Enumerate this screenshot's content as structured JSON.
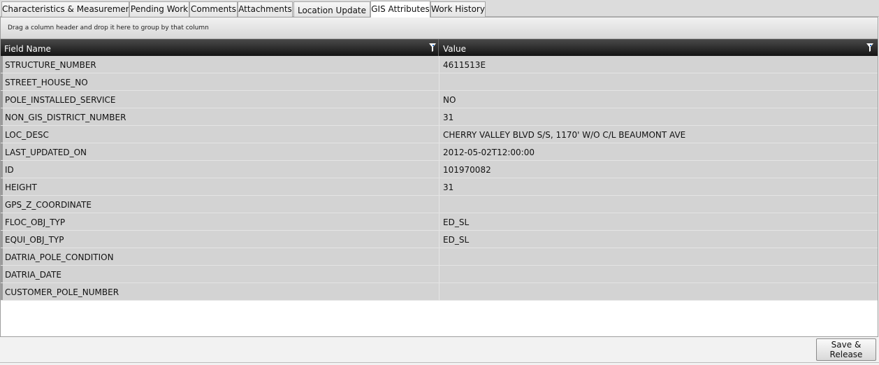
{
  "tabs": [
    {
      "label": "Characteristics & Measurements"
    },
    {
      "label": "Pending Work"
    },
    {
      "label": "Comments"
    },
    {
      "label": "Attachments"
    },
    {
      "label": "Location Update"
    },
    {
      "label": "GIS Attributes"
    },
    {
      "label": "Work History"
    }
  ],
  "active_tab": "GIS Attributes",
  "group_panel_text": "Drag a column header and drop it here to group by that column",
  "grid": {
    "columns": [
      {
        "label": "Field Name",
        "filter_icon": "funnel-filter-icon"
      },
      {
        "label": "Value",
        "filter_icon": "funnel-filter-icon"
      }
    ],
    "rows": [
      {
        "field": "STRUCTURE_NUMBER",
        "value": "4611513E"
      },
      {
        "field": "STREET_HOUSE_NO",
        "value": ""
      },
      {
        "field": "POLE_INSTALLED_SERVICE",
        "value": "NO"
      },
      {
        "field": "NON_GIS_DISTRICT_NUMBER",
        "value": "31"
      },
      {
        "field": "LOC_DESC",
        "value": "CHERRY VALLEY BLVD S/S, 1170' W/O C/L BEAUMONT AVE"
      },
      {
        "field": "LAST_UPDATED_ON",
        "value": "2012-05-02T12:00:00"
      },
      {
        "field": "ID",
        "value": "101970082"
      },
      {
        "field": "HEIGHT",
        "value": "31"
      },
      {
        "field": "GPS_Z_COORDINATE",
        "value": ""
      },
      {
        "field": "FLOC_OBJ_TYP",
        "value": "ED_SL"
      },
      {
        "field": "EQUI_OBJ_TYP",
        "value": "ED_SL"
      },
      {
        "field": "DATRIA_POLE_CONDITION",
        "value": ""
      },
      {
        "field": "DATRIA_DATE",
        "value": ""
      },
      {
        "field": "CUSTOMER_POLE_NUMBER",
        "value": ""
      }
    ]
  },
  "footer": {
    "save_release_label": "Save & Release"
  }
}
